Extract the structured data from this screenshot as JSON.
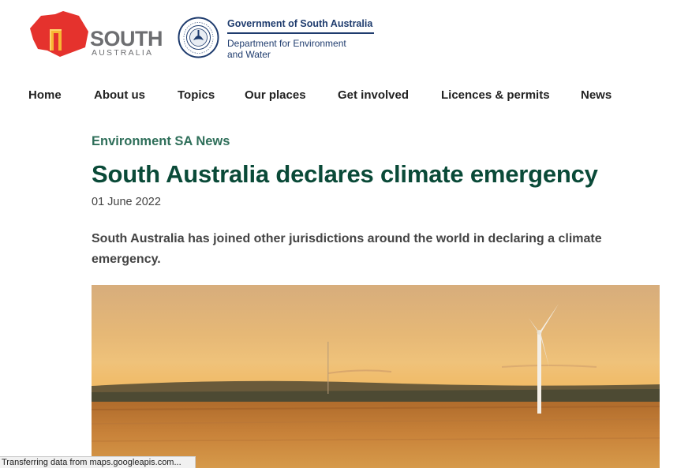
{
  "brand": {
    "logo_line1": "SOUTH",
    "logo_line2": "AUSTRALIA",
    "logo_color": "#e5322d",
    "seal_text": "SOUTH AUSTRALIA",
    "gov_title": "Government of South Australia",
    "dept_line1": "Department for Environment",
    "dept_line2": "and Water"
  },
  "nav": {
    "items": [
      {
        "label": "Home"
      },
      {
        "label": "About us"
      },
      {
        "label": "Topics"
      },
      {
        "label": "Our places"
      },
      {
        "label": "Get involved"
      },
      {
        "label": "Licences & permits"
      },
      {
        "label": "News"
      }
    ]
  },
  "article": {
    "kicker": "Environment SA News",
    "headline": "South Australia declares climate emergency",
    "date": "01 June 2022",
    "lede": "South Australia has joined other jurisdictions around the world in declaring a climate emergency.",
    "hero_image": "wind-turbine-field-at-sunset"
  },
  "status_bar": {
    "text": "Transferring data from maps.googleapis.com..."
  },
  "colors": {
    "headline": "#0a4a38",
    "kicker": "#2f6f5a",
    "gov_blue": "#1f3c6e"
  }
}
